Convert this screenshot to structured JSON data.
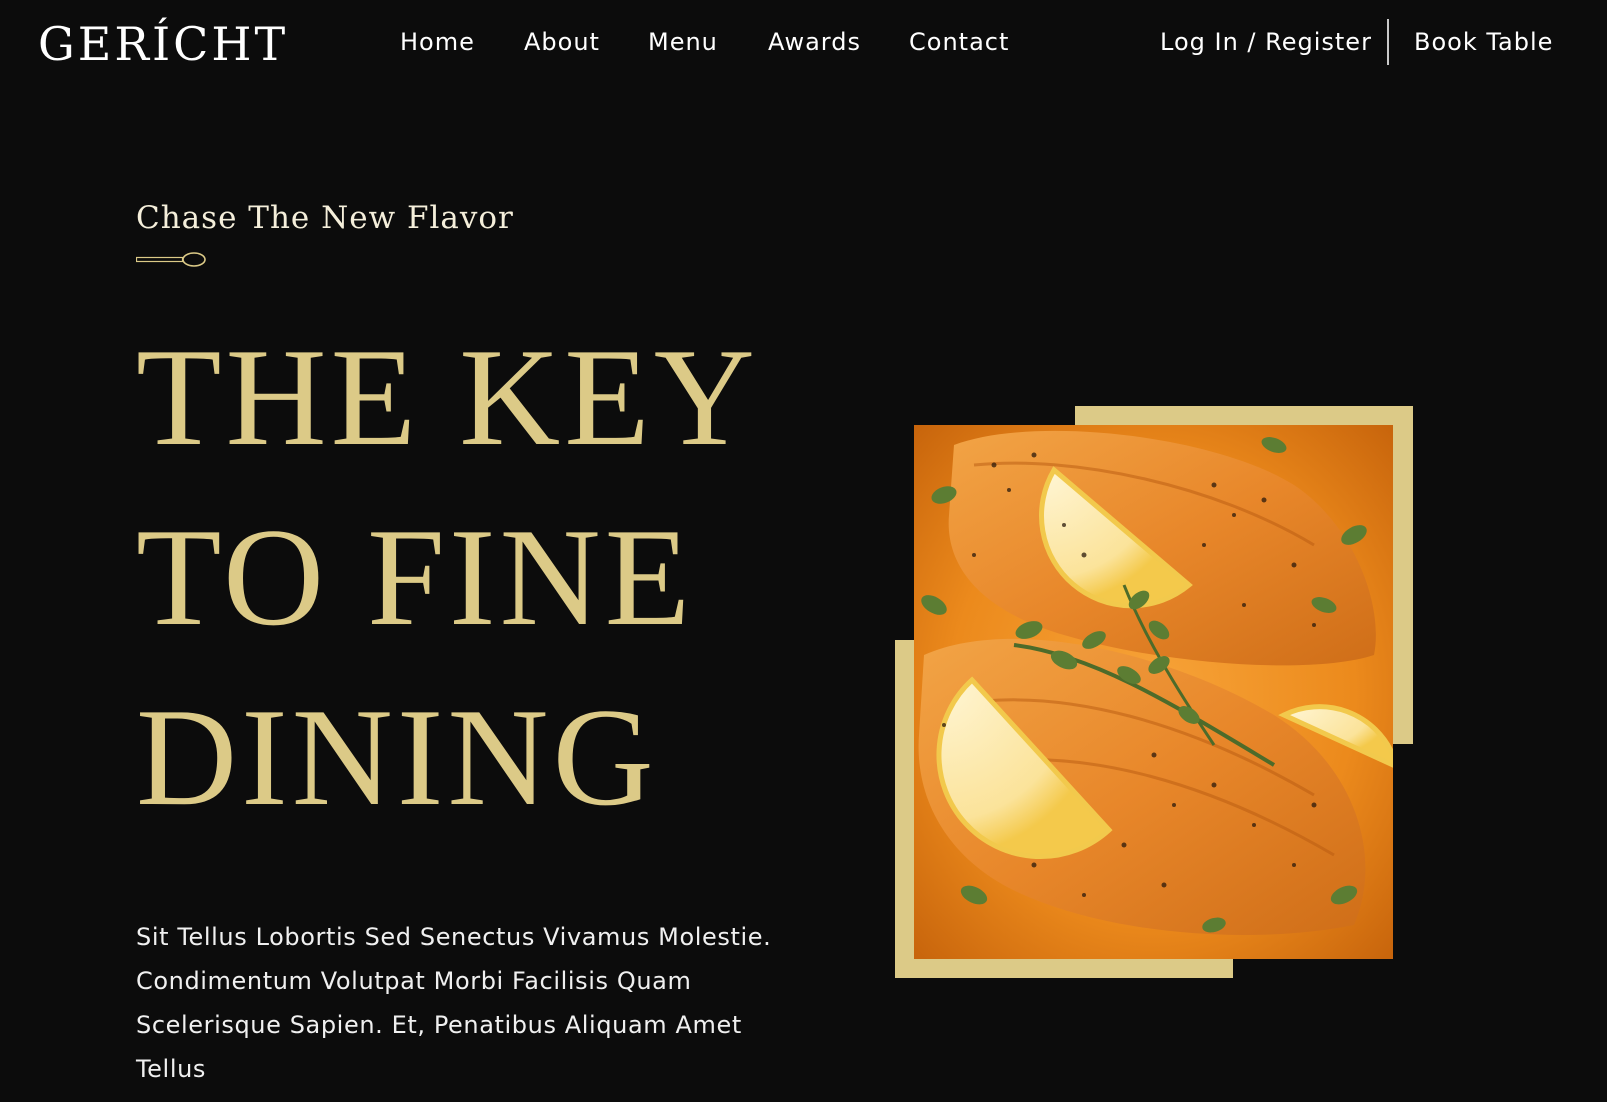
{
  "brand": {
    "logo_text": "GERÍCHT"
  },
  "nav": {
    "links": [
      {
        "label": "Home"
      },
      {
        "label": "About"
      },
      {
        "label": "Menu"
      },
      {
        "label": "Awards"
      },
      {
        "label": "Contact"
      }
    ],
    "login_label": "Log In / Register",
    "book_label": "Book Table"
  },
  "hero": {
    "subtitle": "Chase The New Flavor",
    "spoon_icon": "spoon-icon",
    "headline_lines": [
      "THE KEY",
      "TO FINE",
      "DINING"
    ],
    "description": "Sit Tellus Lobortis Sed Senectus Vivamus Molestie. Condimentum Volutpat Morbi Facilisis Quam Scelerisque Sapien. Et, Penatibus Aliquam Amet Tellus",
    "image_icon": "salmon-dish-image"
  },
  "colors": {
    "background": "#0c0c0c",
    "gold": "#dcca87",
    "text": "#ffffff"
  }
}
